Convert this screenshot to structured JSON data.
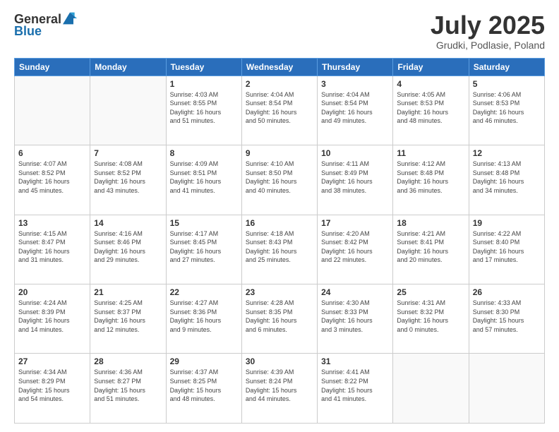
{
  "logo": {
    "general": "General",
    "blue": "Blue"
  },
  "title": "July 2025",
  "location": "Grudki, Podlasie, Poland",
  "headers": [
    "Sunday",
    "Monday",
    "Tuesday",
    "Wednesday",
    "Thursday",
    "Friday",
    "Saturday"
  ],
  "weeks": [
    [
      {
        "day": "",
        "info": ""
      },
      {
        "day": "",
        "info": ""
      },
      {
        "day": "1",
        "info": "Sunrise: 4:03 AM\nSunset: 8:55 PM\nDaylight: 16 hours\nand 51 minutes."
      },
      {
        "day": "2",
        "info": "Sunrise: 4:04 AM\nSunset: 8:54 PM\nDaylight: 16 hours\nand 50 minutes."
      },
      {
        "day": "3",
        "info": "Sunrise: 4:04 AM\nSunset: 8:54 PM\nDaylight: 16 hours\nand 49 minutes."
      },
      {
        "day": "4",
        "info": "Sunrise: 4:05 AM\nSunset: 8:53 PM\nDaylight: 16 hours\nand 48 minutes."
      },
      {
        "day": "5",
        "info": "Sunrise: 4:06 AM\nSunset: 8:53 PM\nDaylight: 16 hours\nand 46 minutes."
      }
    ],
    [
      {
        "day": "6",
        "info": "Sunrise: 4:07 AM\nSunset: 8:52 PM\nDaylight: 16 hours\nand 45 minutes."
      },
      {
        "day": "7",
        "info": "Sunrise: 4:08 AM\nSunset: 8:52 PM\nDaylight: 16 hours\nand 43 minutes."
      },
      {
        "day": "8",
        "info": "Sunrise: 4:09 AM\nSunset: 8:51 PM\nDaylight: 16 hours\nand 41 minutes."
      },
      {
        "day": "9",
        "info": "Sunrise: 4:10 AM\nSunset: 8:50 PM\nDaylight: 16 hours\nand 40 minutes."
      },
      {
        "day": "10",
        "info": "Sunrise: 4:11 AM\nSunset: 8:49 PM\nDaylight: 16 hours\nand 38 minutes."
      },
      {
        "day": "11",
        "info": "Sunrise: 4:12 AM\nSunset: 8:48 PM\nDaylight: 16 hours\nand 36 minutes."
      },
      {
        "day": "12",
        "info": "Sunrise: 4:13 AM\nSunset: 8:48 PM\nDaylight: 16 hours\nand 34 minutes."
      }
    ],
    [
      {
        "day": "13",
        "info": "Sunrise: 4:15 AM\nSunset: 8:47 PM\nDaylight: 16 hours\nand 31 minutes."
      },
      {
        "day": "14",
        "info": "Sunrise: 4:16 AM\nSunset: 8:46 PM\nDaylight: 16 hours\nand 29 minutes."
      },
      {
        "day": "15",
        "info": "Sunrise: 4:17 AM\nSunset: 8:45 PM\nDaylight: 16 hours\nand 27 minutes."
      },
      {
        "day": "16",
        "info": "Sunrise: 4:18 AM\nSunset: 8:43 PM\nDaylight: 16 hours\nand 25 minutes."
      },
      {
        "day": "17",
        "info": "Sunrise: 4:20 AM\nSunset: 8:42 PM\nDaylight: 16 hours\nand 22 minutes."
      },
      {
        "day": "18",
        "info": "Sunrise: 4:21 AM\nSunset: 8:41 PM\nDaylight: 16 hours\nand 20 minutes."
      },
      {
        "day": "19",
        "info": "Sunrise: 4:22 AM\nSunset: 8:40 PM\nDaylight: 16 hours\nand 17 minutes."
      }
    ],
    [
      {
        "day": "20",
        "info": "Sunrise: 4:24 AM\nSunset: 8:39 PM\nDaylight: 16 hours\nand 14 minutes."
      },
      {
        "day": "21",
        "info": "Sunrise: 4:25 AM\nSunset: 8:37 PM\nDaylight: 16 hours\nand 12 minutes."
      },
      {
        "day": "22",
        "info": "Sunrise: 4:27 AM\nSunset: 8:36 PM\nDaylight: 16 hours\nand 9 minutes."
      },
      {
        "day": "23",
        "info": "Sunrise: 4:28 AM\nSunset: 8:35 PM\nDaylight: 16 hours\nand 6 minutes."
      },
      {
        "day": "24",
        "info": "Sunrise: 4:30 AM\nSunset: 8:33 PM\nDaylight: 16 hours\nand 3 minutes."
      },
      {
        "day": "25",
        "info": "Sunrise: 4:31 AM\nSunset: 8:32 PM\nDaylight: 16 hours\nand 0 minutes."
      },
      {
        "day": "26",
        "info": "Sunrise: 4:33 AM\nSunset: 8:30 PM\nDaylight: 15 hours\nand 57 minutes."
      }
    ],
    [
      {
        "day": "27",
        "info": "Sunrise: 4:34 AM\nSunset: 8:29 PM\nDaylight: 15 hours\nand 54 minutes."
      },
      {
        "day": "28",
        "info": "Sunrise: 4:36 AM\nSunset: 8:27 PM\nDaylight: 15 hours\nand 51 minutes."
      },
      {
        "day": "29",
        "info": "Sunrise: 4:37 AM\nSunset: 8:25 PM\nDaylight: 15 hours\nand 48 minutes."
      },
      {
        "day": "30",
        "info": "Sunrise: 4:39 AM\nSunset: 8:24 PM\nDaylight: 15 hours\nand 44 minutes."
      },
      {
        "day": "31",
        "info": "Sunrise: 4:41 AM\nSunset: 8:22 PM\nDaylight: 15 hours\nand 41 minutes."
      },
      {
        "day": "",
        "info": ""
      },
      {
        "day": "",
        "info": ""
      }
    ]
  ]
}
